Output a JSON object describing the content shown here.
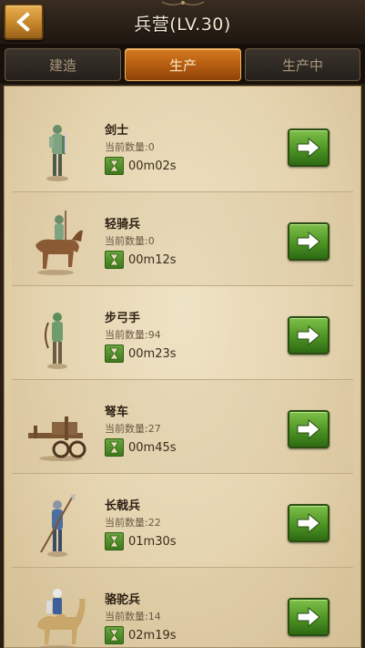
{
  "header": {
    "title": "兵营(LV.30)",
    "back_icon": "back-arrow-icon"
  },
  "tabs": [
    {
      "label": "建造",
      "active": false
    },
    {
      "label": "生产",
      "active": true
    },
    {
      "label": "生产中",
      "active": false
    }
  ],
  "units": [
    {
      "name": "剑士",
      "count_label": "当前数量:",
      "count": "0",
      "time": "00m02s",
      "icon": "swordsman-icon"
    },
    {
      "name": "轻骑兵",
      "count_label": "当前数量:",
      "count": "0",
      "time": "00m12s",
      "icon": "light-cavalry-icon"
    },
    {
      "name": "步弓手",
      "count_label": "当前数量:",
      "count": "94",
      "time": "00m23s",
      "icon": "archer-icon"
    },
    {
      "name": "弩车",
      "count_label": "当前数量:",
      "count": "27",
      "time": "00m45s",
      "icon": "ballista-icon"
    },
    {
      "name": "长戟兵",
      "count_label": "当前数量:",
      "count": "22",
      "time": "01m30s",
      "icon": "halberdier-icon"
    },
    {
      "name": "骆驼兵",
      "count_label": "当前数量:",
      "count": "14",
      "time": "02m19s",
      "icon": "camel-rider-icon"
    }
  ],
  "colors": {
    "accent_tab": "#c0661a",
    "go_button": "#4d9324",
    "parchment": "#e4d3ae"
  }
}
